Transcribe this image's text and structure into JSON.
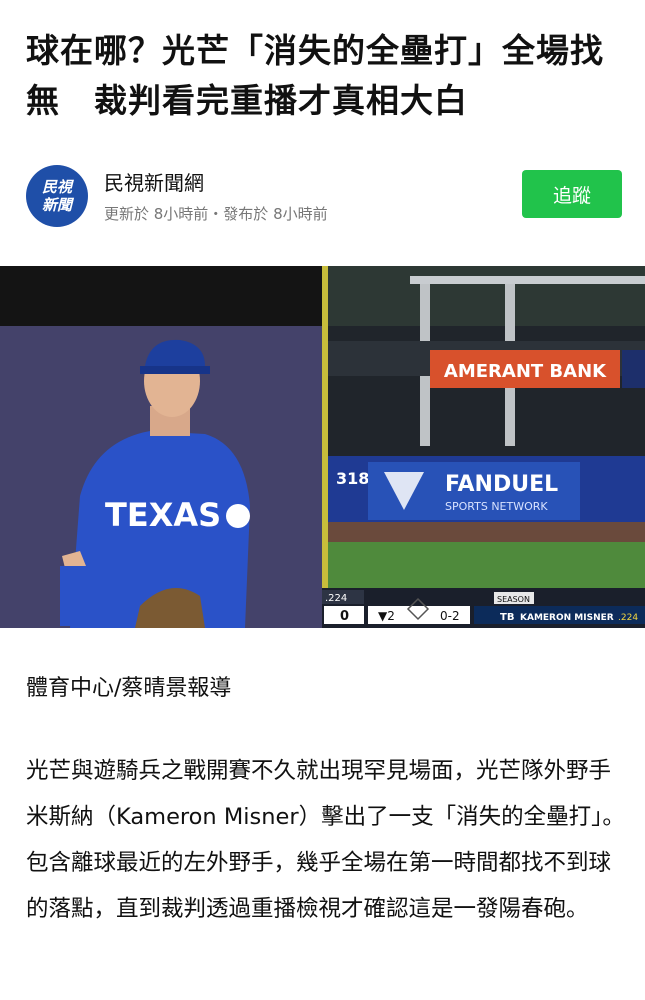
{
  "article": {
    "headline": "球在哪？光芒「消失的全壘打」全場找無　裁判看完重播才真相大白",
    "byline": "體育中心/蔡晴景報導",
    "body": "光芒與遊騎兵之戰開賽不久就出現罕見場面，光芒隊外野手米斯納（Kameron Misner）擊出了一支「消失的全壘打」。包含離球最近的左外野手，幾乎全場在第一時間都找不到球的落點，直到裁判透過重播檢視才確認這是一發陽春砲。"
  },
  "source": {
    "logo_line1": "民視",
    "logo_line2": "新聞",
    "name": "民視新聞網",
    "meta": "更新於 8小時前・發布於 8小時前",
    "follow_label": "追蹤"
  },
  "image": {
    "jersey_text": "TEXAS",
    "wall_distance": "318",
    "sponsor_bank": "AMERANT BANK",
    "sponsor_fanduel": "FANDUEL",
    "sponsor_fanduel_sub": "SPORTS NETWORK",
    "scorebug": {
      "away_avg": ".224",
      "away_runs": "0",
      "inning": "▼2",
      "count": "0-2",
      "season_label": "SEASON",
      "batter_team": "TB",
      "batter_name": "KAMERON MISNER",
      "batter_avg": ".224"
    }
  },
  "colors": {
    "follow_green": "#21c34b",
    "logo_blue": "#1f4fa8",
    "meta_gray": "#777777"
  }
}
